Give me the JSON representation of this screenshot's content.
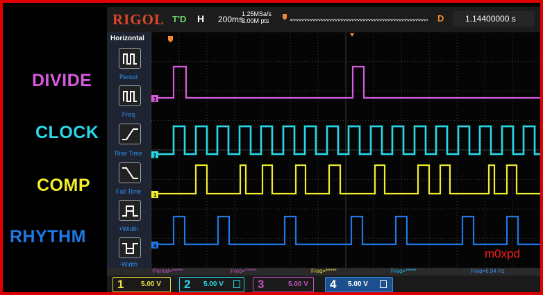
{
  "labels": {
    "divide": "DIVIDE",
    "clock": "CLOCK",
    "comp": "COMP",
    "rhythm": "RHYTHM"
  },
  "colors": {
    "divide": "#d65be0",
    "clock": "#28d8e8",
    "comp": "#f2ef2a",
    "rhythm": "#1f78e6",
    "border": "#e00000",
    "watermark": "#ff1a1a"
  },
  "scope": {
    "brand": "RIGOL",
    "trigger_state": "T'D",
    "h_label": "H",
    "timebase": "200ms",
    "sample_rate": "1.25MSa/s",
    "memory_depth": "3.00M pts",
    "delay_label": "D",
    "delay_value": "1.14400000 s"
  },
  "menu": {
    "title": "Horizontal",
    "items": [
      {
        "label": "Period",
        "icon": "period-icon"
      },
      {
        "label": "Freq",
        "icon": "frequency-icon"
      },
      {
        "label": "Rise Time",
        "icon": "rise-time-icon"
      },
      {
        "label": "Fall Time",
        "icon": "fall-time-icon"
      },
      {
        "label": "+Width",
        "icon": "positive-width-icon"
      },
      {
        "label": "-Width",
        "icon": "negative-width-icon"
      }
    ]
  },
  "measurements": [
    {
      "text": "Period=*****",
      "color": "#c050c0"
    },
    {
      "text": "Freq=*****",
      "color": "#c050c0"
    },
    {
      "text": "Freq=*****",
      "color": "#e8e040"
    },
    {
      "text": "Freq=*****",
      "color": "#28b8e8"
    },
    {
      "text": "Freq=6.94 Hz",
      "color": "#3a8ee8"
    }
  ],
  "channels": [
    {
      "num": "1",
      "value": "5.00 V",
      "color": "#e8e040"
    },
    {
      "num": "2",
      "value": "5.00 V",
      "color": "#28d8e8"
    },
    {
      "num": "3",
      "value": "5.00 V",
      "color": "#c050c0"
    },
    {
      "num": "4",
      "value": "5.00 V",
      "color": "#3a8ee8"
    }
  ],
  "watermark": "m0xpd"
}
